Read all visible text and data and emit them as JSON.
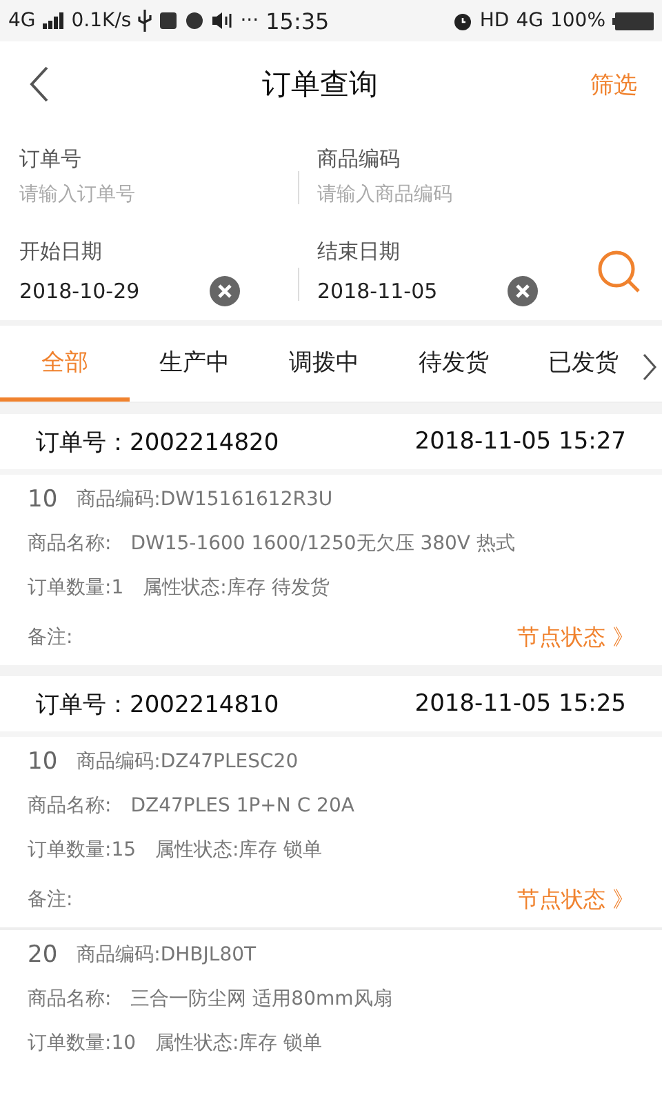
{
  "status_bar": {
    "network": "4G",
    "speed": "0.1K/s",
    "dots": "···",
    "time": "15:35",
    "hd": "HD",
    "network_right": "4G",
    "battery": "100%"
  },
  "nav": {
    "title": "订单查询",
    "filter": "筛选"
  },
  "search": {
    "fields": [
      {
        "label": "订单号",
        "placeholder": "请输入订单号",
        "kind": "text"
      },
      {
        "label": "商品编码",
        "placeholder": "请输入商品编码",
        "kind": "text"
      },
      {
        "label": "开始日期",
        "value": "2018-10-29",
        "kind": "date"
      },
      {
        "label": "结束日期",
        "value": "2018-11-05",
        "kind": "date"
      }
    ]
  },
  "tabs": [
    {
      "label": "全部",
      "selected": true
    },
    {
      "label": "生产中",
      "selected": false
    },
    {
      "label": "调拨中",
      "selected": false
    },
    {
      "label": "待发货",
      "selected": false
    },
    {
      "label": "已发货",
      "selected": false
    }
  ],
  "orders": [
    {
      "order_label": "订单号：",
      "order_no": "2002214820",
      "time": "2018-11-05 15:27",
      "items": [
        {
          "line_no": "10",
          "code": "商品编码:DW15161612R3U",
          "name_label": "商品名称:",
          "name": "DW15-1600 1600/1250无欠压 380V 热式",
          "qty": "订单数量:1",
          "state": "属性状态:库存 待发货",
          "remark": "备注:",
          "node_status": "节点状态 》"
        }
      ]
    },
    {
      "order_label": "订单号：",
      "order_no": "2002214810",
      "time": "2018-11-05 15:25",
      "items": [
        {
          "line_no": "10",
          "code": "商品编码:DZ47PLESC20",
          "name_label": "商品名称:",
          "name": "DZ47PLES 1P+N C 20A",
          "qty": "订单数量:15",
          "state": "属性状态:库存 锁单",
          "remark": "备注:",
          "node_status": "节点状态 》"
        },
        {
          "line_no": "20",
          "code": "商品编码:DHBJL80T",
          "name_label": "商品名称:",
          "name": "三合一防尘网 适用80mm风扇",
          "qty": "订单数量:10",
          "state": "属性状态:库存 锁单"
        }
      ]
    }
  ]
}
